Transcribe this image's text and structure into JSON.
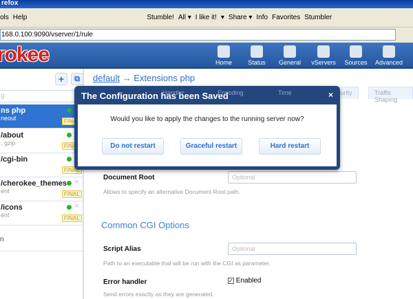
{
  "browser": {
    "title": "refox",
    "menu": [
      "ols",
      "Help"
    ],
    "toolbar": [
      "Stumble!",
      "All ▾",
      "I like it!",
      "▾",
      "Share ▾",
      "Info",
      "Favorites",
      "Stumbler"
    ],
    "url": "168.0.100:9090/vserver/1/rule"
  },
  "header": {
    "logo": "rokee",
    "nav": [
      "Home",
      "Status",
      "General",
      "vServers",
      "Sources",
      "Advanced"
    ]
  },
  "sidebar": {
    "add": "+",
    "clone": "⧉",
    "filter_placeholder": "g",
    "items": [
      {
        "title": "ns php",
        "sub": "neout",
        "badge": "FINAL"
      },
      {
        "title": "/about",
        "sub": ", gzip",
        "badge": "FINAL"
      },
      {
        "title": "/cgi-bin",
        "sub": "",
        "badge": "FINAL"
      },
      {
        "title": "/cherokee_themes",
        "sub": "ent",
        "badge": "FINAL"
      },
      {
        "title": "/icons",
        "sub": "ent",
        "badge": "FINAL"
      }
    ],
    "last": "n"
  },
  "main": {
    "crumb_link": "default",
    "crumb_rest": " → Extensions php",
    "tabs": [
      "Handler",
      "Encoding",
      "Time",
      "Security",
      "Traffic Shaping"
    ],
    "docroot": {
      "label": "Document Root",
      "placeholder": "Optional",
      "hint": "Allows to specify an alternative Document Root path."
    },
    "section": "Common CGI Options",
    "alias": {
      "label": "Script Alias",
      "placeholder": "Optional",
      "hint": "Path to an executable that will be run with the CGI as parameter."
    },
    "error": {
      "label": "Error handler",
      "value": "Enabled",
      "hint": "Send errors exactly as they are generated."
    }
  },
  "dialog": {
    "title": "The Configuration has been Saved",
    "close": "×",
    "question": "Would you like to apply the changes to the running server now?",
    "buttons": [
      "Do not restart",
      "Graceful restart",
      "Hard restart"
    ]
  }
}
